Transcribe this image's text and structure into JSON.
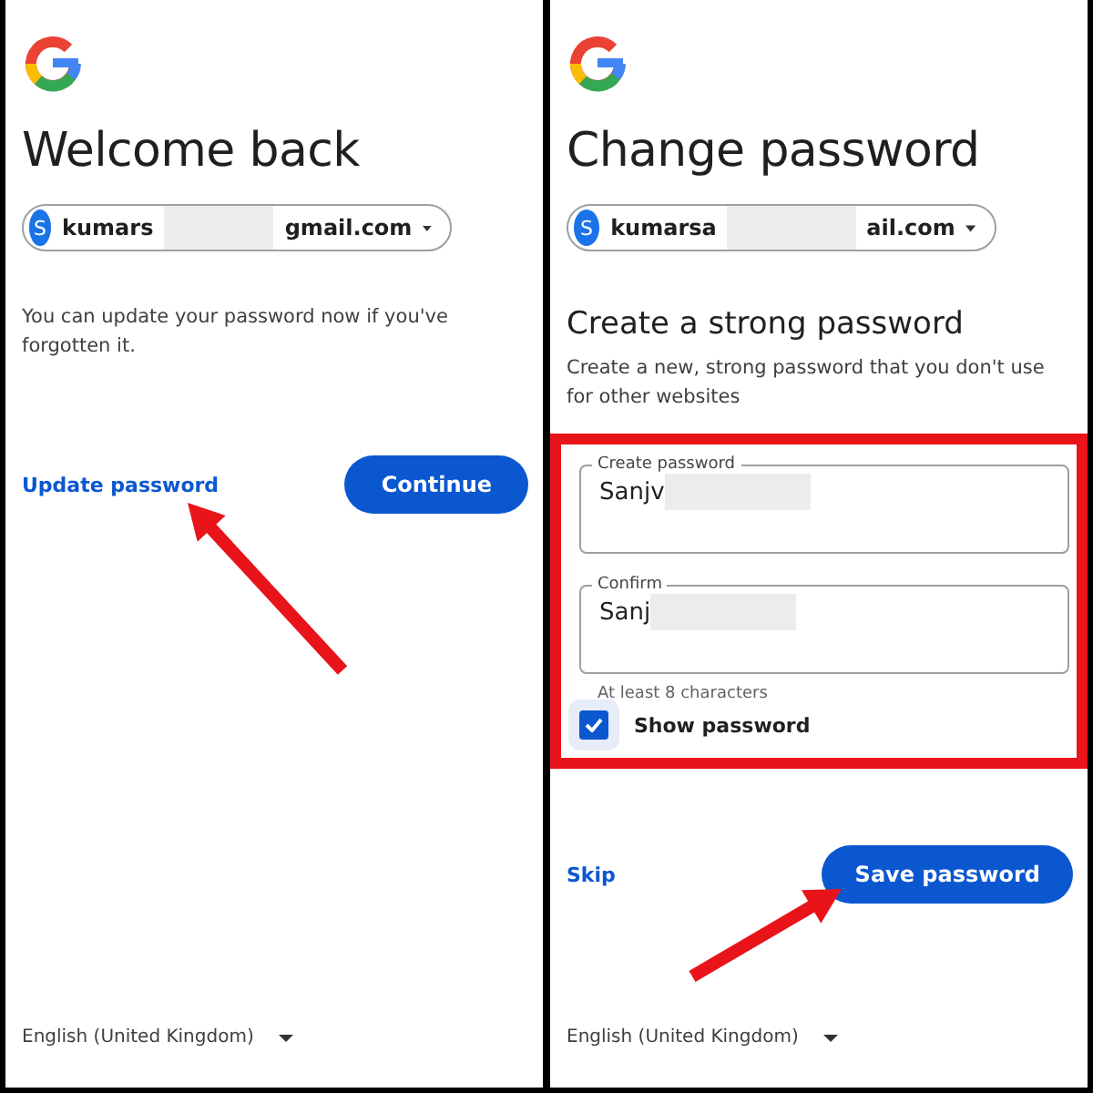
{
  "panels": [
    {
      "kind": "welcome",
      "title": "Welcome back",
      "account": {
        "avatar": "S",
        "email_start": "kumars",
        "email_end": "gmail.com"
      },
      "message": "You can update your password now if you've forgotten it.",
      "link": "Update password",
      "button": "Continue",
      "language": "English (United Kingdom)"
    },
    {
      "kind": "change",
      "title": "Change password",
      "account": {
        "avatar": "S",
        "email_start": "kumarsa",
        "email_end": "ail.com"
      },
      "subtitle": "Create a strong password",
      "message": "Create a new, strong password that you don't use for other websites",
      "fields": [
        {
          "label": "Create password",
          "value": "Sanjv"
        },
        {
          "label": "Confirm",
          "value": "Sanj"
        }
      ],
      "hint": "At least 8 characters",
      "show_password": {
        "label": "Show password",
        "checked": true
      },
      "link": "Skip",
      "button": "Save password",
      "language": "English (United Kingdom)"
    }
  ]
}
